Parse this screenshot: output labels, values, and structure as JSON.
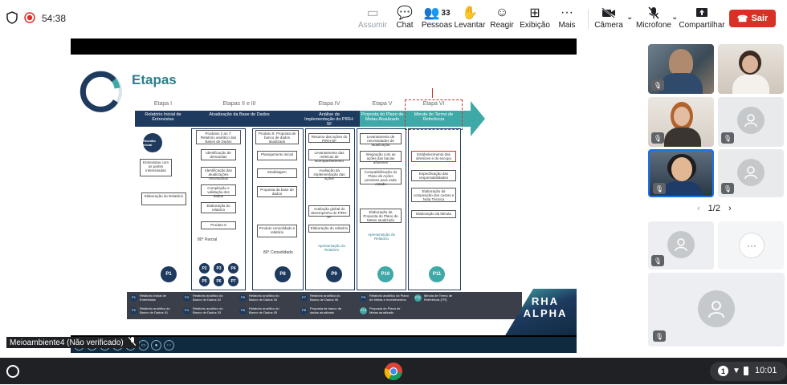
{
  "meeting": {
    "timer": "54:38"
  },
  "toolbar": {
    "assumir": "Assumir",
    "chat": "Chat",
    "pessoas": "Pessoas",
    "people_count": "33",
    "levantar": "Levantar",
    "reagir": "Reagir",
    "exibicao": "Exibição",
    "mais": "Mais",
    "camera": "Câmera",
    "microfone": "Microfone",
    "compartilhar": "Compartilhar",
    "sair": "Sair"
  },
  "slide": {
    "title": "Etapas",
    "phases": [
      {
        "head": "Etapa I",
        "title": "Relatório Inicial de Entrevistas"
      },
      {
        "head": "Etapas II e III",
        "title": "Atualização da Base de Dados"
      },
      {
        "head": "Etapa IV",
        "title": "Análise da Implementação do PIRH-SF"
      },
      {
        "head": "Etapa V",
        "title": "Proposta do Plano de Metas Atualizado"
      },
      {
        "head": "Etapa VI",
        "title": "Minuta do Termo de Referência"
      }
    ],
    "col1": [
      "Reunião Inicial",
      "Entrevistas com as partes interessadas",
      "Elaboração do Relatório"
    ],
    "col2": [
      "Produtos 2 ao 7: Relatório analítico das Bases de Dados",
      "Identificação de demandas",
      "Identificação das atualizações necessárias",
      "Compilação e validação dos dados",
      "Elaboração do relatório",
      "Produto 8"
    ],
    "col2_note": "80° Parcial",
    "col3": [
      "Produto 8: Proposta de banco de dados atualizado",
      "Planejamento inicial",
      "Modelagem",
      "Proposta da base de dados",
      "Produto consolidado e relatório"
    ],
    "col3_note": "80° Consolidado",
    "col4": [
      "Resumo das ações do PIRH-SF",
      "Levantamento das métricas de acompanhamento",
      "Avaliação da implementação das ações",
      "Avaliação global do desempenho do PIRH-SF",
      "Elaboração do relatório"
    ],
    "col4_note": "Apresentação do Relatório",
    "col5": [
      "Levantamento de necessidades de atualização",
      "Integração com as ações das bacias afluentes",
      "Compatibilização do Plano de Ações previstos para cada estado",
      "Elaboração da Proposta do Plano de Metas atualizado"
    ],
    "col5_note": "Apresentação do Relatório",
    "col6": [
      "Estabelecimento das diretrizes e do escopo",
      "Especificação das responsabilidades",
      "Elaboração da composição dos custos e Nota Técnica",
      "Elaboração da Minuta"
    ],
    "circles": [
      "P1",
      "P2",
      "P3",
      "P4",
      "P5",
      "P6",
      "P7",
      "P8",
      "P9",
      "P10",
      "P11"
    ],
    "legend": [
      {
        "code": "P1",
        "text": "Relatório Inicial de Entrevistas"
      },
      {
        "code": "P2",
        "text": "Relatório analítico do Banco de Dados 01"
      },
      {
        "code": "P3",
        "text": "Relatório analítico do Banco de Dados 02"
      },
      {
        "code": "P4",
        "text": "Relatório analítico do Banco de Dados 03"
      },
      {
        "code": "P5",
        "text": "Relatório analítico do Banco de Dados 04"
      },
      {
        "code": "P6",
        "text": "Relatório analítico do Banco de Dados 05"
      },
      {
        "code": "P7",
        "text": "Relatório analítico do Banco de Dados 06"
      },
      {
        "code": "P8",
        "text": "Proposta de banco de dados atualizado"
      },
      {
        "code": "P9",
        "text": "Relatório analítico do Plano de Metas e Investimentos"
      },
      {
        "code": "P10",
        "text": "Proposta do Plano de Metas atualizado"
      },
      {
        "code": "P11",
        "text": "Minuta de Termo de Referência (TR)"
      }
    ],
    "brand": "RHA ALPHA"
  },
  "presenter": {
    "name": "Meioambiente4 (Não verificado)"
  },
  "pagination": {
    "label": "1/2"
  },
  "taskbar": {
    "badge": "1",
    "clock": "10:01"
  }
}
